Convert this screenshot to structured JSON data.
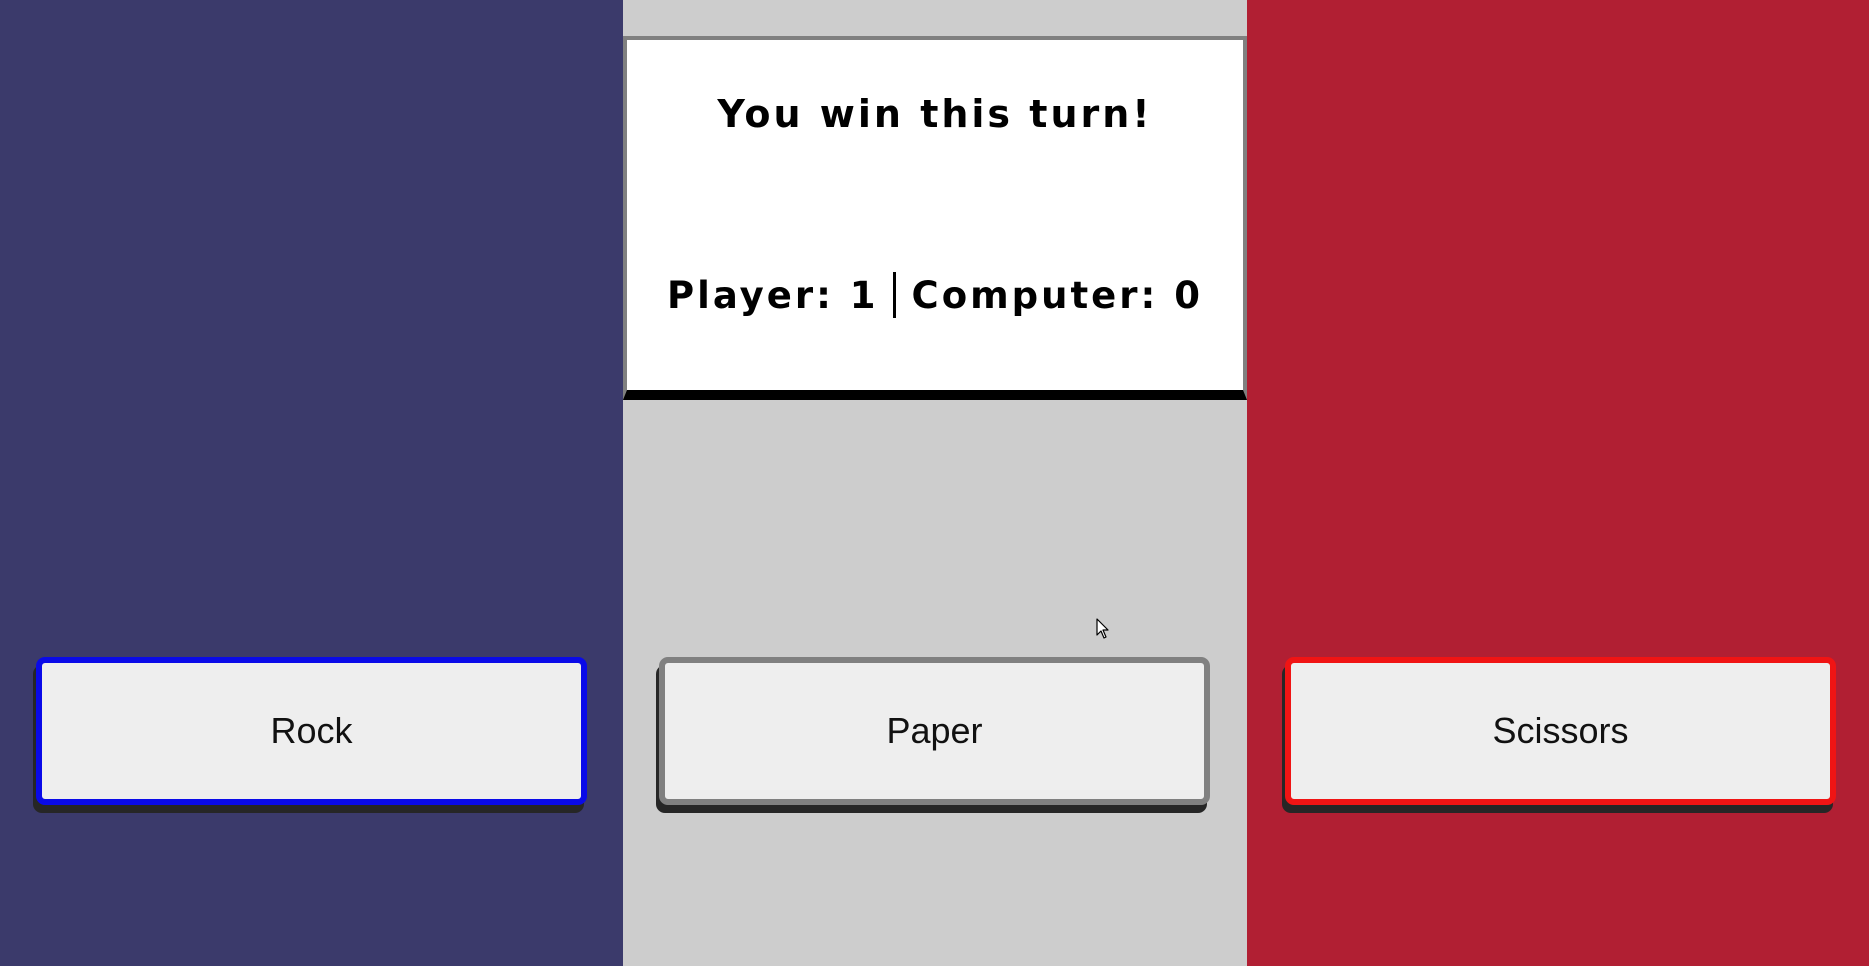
{
  "colors": {
    "rock_panel": "#3b3a6b",
    "paper_panel": "#cdcdcd",
    "scissors_panel": "#b11f33",
    "rock_border": "#0a0ae8",
    "paper_border": "#808080",
    "scissors_border": "#f01414",
    "button_fill": "#eeeeee"
  },
  "result": {
    "message": "You win this turn!",
    "player_label": "Player:",
    "player_score": "1",
    "computer_label": "Computer:",
    "computer_score": "0"
  },
  "buttons": {
    "rock": "Rock",
    "paper": "Paper",
    "scissors": "Scissors"
  },
  "cursor": {
    "icon": "arrow-cursor-icon"
  }
}
